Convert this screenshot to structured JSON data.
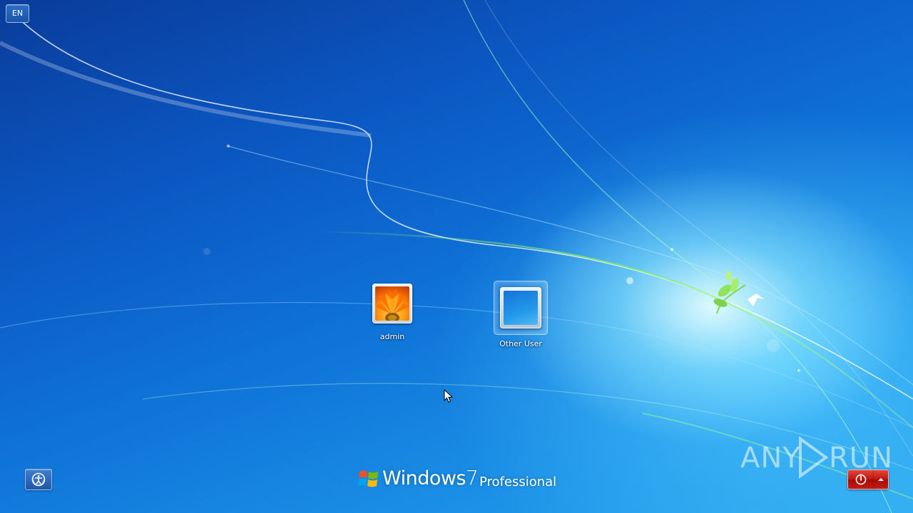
{
  "screen": {
    "title": "Windows 7 logon screen"
  },
  "language_indicator": {
    "label": "EN"
  },
  "users": [
    {
      "name": "admin",
      "picture": "orange-flower-icon",
      "selected": false
    },
    {
      "name": "Other User",
      "picture": "blank-user-icon",
      "selected": true
    }
  ],
  "branding": {
    "product": "Windows",
    "version": "7",
    "edition": "Professional"
  },
  "watermark": {
    "left": "ANY",
    "right": "RUN"
  },
  "buttons": {
    "ease_of_access_icon": "ease-of-access-icon",
    "shutdown_icon": "power-icon",
    "shutdown_options_icon": "chevron-up-icon"
  },
  "colors": {
    "background_dark": "#0a3c9a",
    "background_light": "#2aa8ee",
    "shutdown_red": "#c2180f",
    "text": "#ffffff"
  }
}
